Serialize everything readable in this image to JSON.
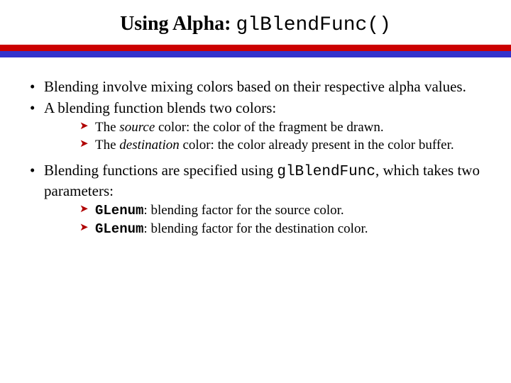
{
  "title": {
    "prefix": "Using Alpha: ",
    "code": "glBlendFunc()"
  },
  "bullets": [
    {
      "text": "Blending involve mixing colors based on their respective alpha values."
    },
    {
      "text": "A blending function blends two colors:",
      "sub": [
        {
          "pre": "The ",
          "em": "source",
          "post": " color: the color of the fragment be drawn."
        },
        {
          "pre": "The ",
          "em": "destination",
          "post": " color: the color already present in the color buffer."
        }
      ]
    },
    {
      "pre": "Blending functions are specified using ",
      "code": "glBlendFunc",
      "post": ", which takes two parameters:",
      "sub": [
        {
          "code": "GLenum",
          "post": ": blending factor for the source color."
        },
        {
          "code": "GLenum",
          "post": ": blending factor for the destination color."
        }
      ]
    }
  ]
}
